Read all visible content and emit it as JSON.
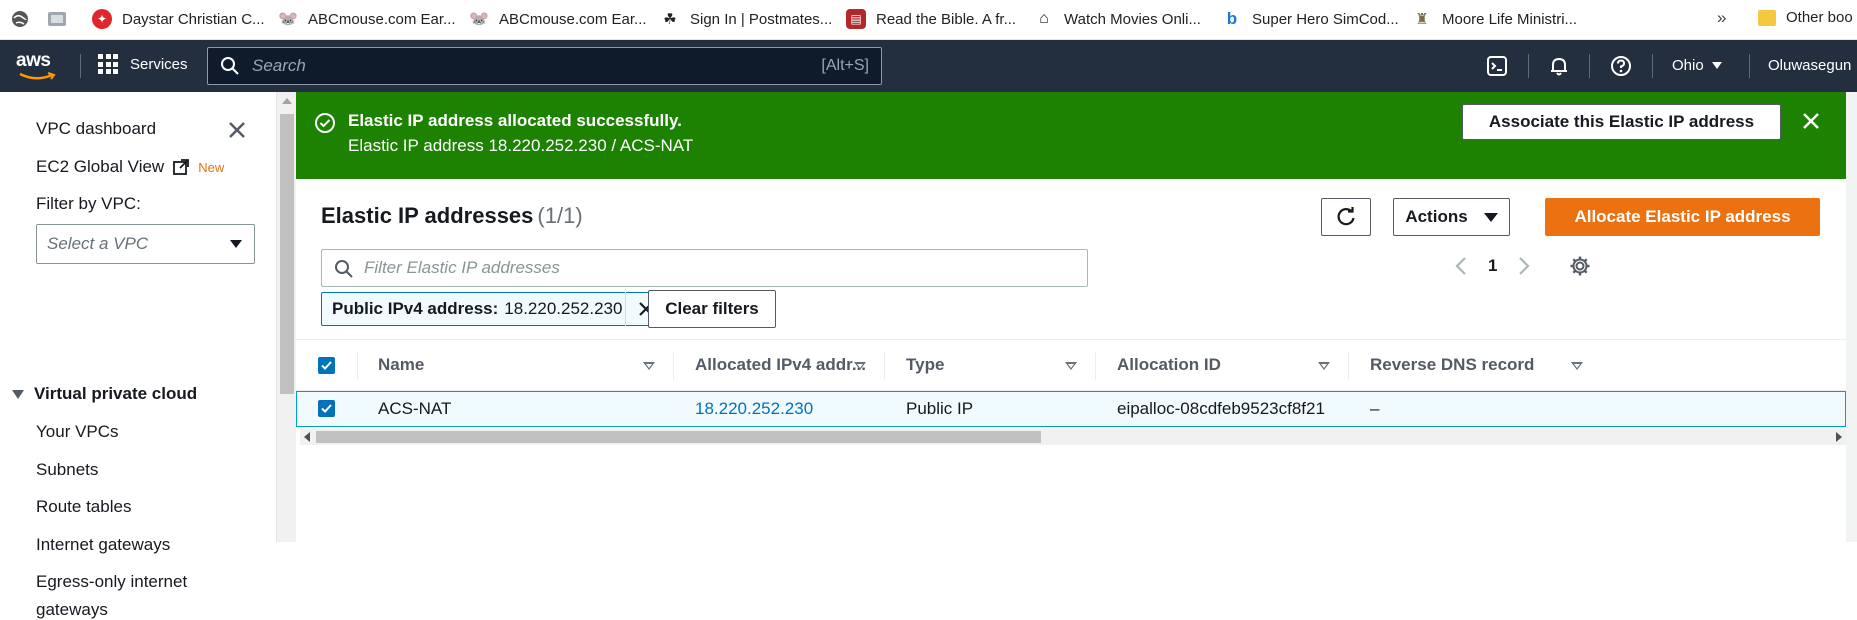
{
  "bookmarks": [
    {
      "label": "",
      "icon": "globe-icon"
    },
    {
      "label": "",
      "icon": "image-bookmark-icon"
    },
    {
      "label": "Daystar Christian C...",
      "icon": "daystar-icon",
      "color": "#e0262a"
    },
    {
      "label": "ABCmouse.com Ear...",
      "icon": "mouse-icon"
    },
    {
      "label": "ABCmouse.com Ear...",
      "icon": "mouse-icon"
    },
    {
      "label": "Sign In | Postmates...",
      "icon": "postmates-icon"
    },
    {
      "label": "Read the Bible. A fr...",
      "icon": "bible-icon",
      "color": "#b3262a"
    },
    {
      "label": "Watch Movies Onli...",
      "icon": "tv-icon"
    },
    {
      "label": "Super Hero SimCod...",
      "icon": "bing-icon",
      "color": "#1a7bd6"
    },
    {
      "label": "Moore Life Ministri...",
      "icon": "church-icon"
    }
  ],
  "bookmarks_more": "»",
  "other_bookmarks": "Other boo",
  "header": {
    "logo": "aws",
    "services": "Services",
    "search_placeholder": "Search",
    "search_shortcut": "[Alt+S]",
    "region": "Ohio",
    "user": "Oluwasegun"
  },
  "sidebar": {
    "dashboard": "VPC dashboard",
    "global_view": "EC2 Global View",
    "new_badge": "New",
    "filter_label": "Filter by VPC:",
    "vpc_select_placeholder": "Select a VPC",
    "section": "Virtual private cloud",
    "items": [
      "Your VPCs",
      "Subnets",
      "Route tables",
      "Internet gateways",
      "Egress-only internet",
      "gateways"
    ]
  },
  "flash": {
    "title": "Elastic IP address allocated successfully.",
    "detail": "Elastic IP address 18.220.252.230 / ACS-NAT",
    "associate_button": "Associate this Elastic IP address"
  },
  "panel": {
    "title": "Elastic IP addresses",
    "count": "(1/1)",
    "actions": "Actions",
    "allocate": "Allocate Elastic IP address",
    "filter_placeholder": "Filter Elastic IP addresses",
    "page": "1",
    "token_key": "Public IPv4 address:",
    "token_value": "18.220.252.230",
    "clear_filters": "Clear filters"
  },
  "table": {
    "columns": [
      "Name",
      "Allocated IPv4 addr...",
      "Type",
      "Allocation ID",
      "Reverse DNS record"
    ],
    "rows": [
      {
        "name": "ACS-NAT",
        "ip": "18.220.252.230",
        "type": "Public IP",
        "allocation_id": "eipalloc-08cdfeb9523cf8f21",
        "reverse_dns": "–",
        "selected": true
      }
    ]
  },
  "colors": {
    "aws_header": "#232f3e",
    "success": "#1d8102",
    "primary": "#ec7211",
    "link": "#0073bb"
  }
}
